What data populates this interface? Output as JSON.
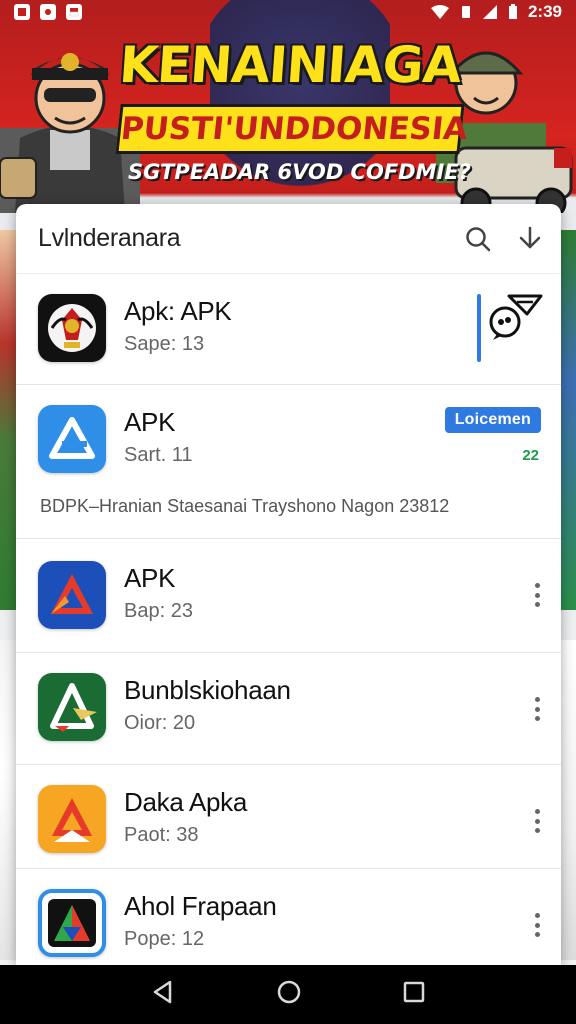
{
  "status_bar": {
    "time": "2:39"
  },
  "banner": {
    "headline": "KENAINIAGA",
    "subheadline": "PUSTI'UNDDONESIA",
    "tagline": "SGTPEADAR 6VOD COFDMIE?"
  },
  "sheet": {
    "title": "Lvlnderanara"
  },
  "apps": [
    {
      "name": "Apk: APK",
      "meta": "Sape: 13",
      "icon": "emblem-app-icon"
    },
    {
      "name": "APK",
      "meta": "Sart. 11",
      "desc": "BDPK–Hranian Staesanai Trayshono Nagon 23812",
      "button": "Loicemen",
      "badge": "22",
      "icon": "blue-triangle-app-icon"
    },
    {
      "name": "APK",
      "meta": "Bap: 23",
      "icon": "red-triangle-app-icon"
    },
    {
      "name": "Bunblskiohaan",
      "meta": "Oior: 20",
      "icon": "green-triangle-app-icon"
    },
    {
      "name": "Daka Apka",
      "meta": "Paot: 38",
      "icon": "orange-triangle-app-icon"
    },
    {
      "name": "Ahol Frapaan",
      "meta": "Pope: 12",
      "icon": "multicolor-app-icon"
    }
  ],
  "colors": {
    "accent_blue": "#2f7ae0",
    "banner_red": "#c41f1c",
    "banner_yellow": "#ffe11a"
  }
}
